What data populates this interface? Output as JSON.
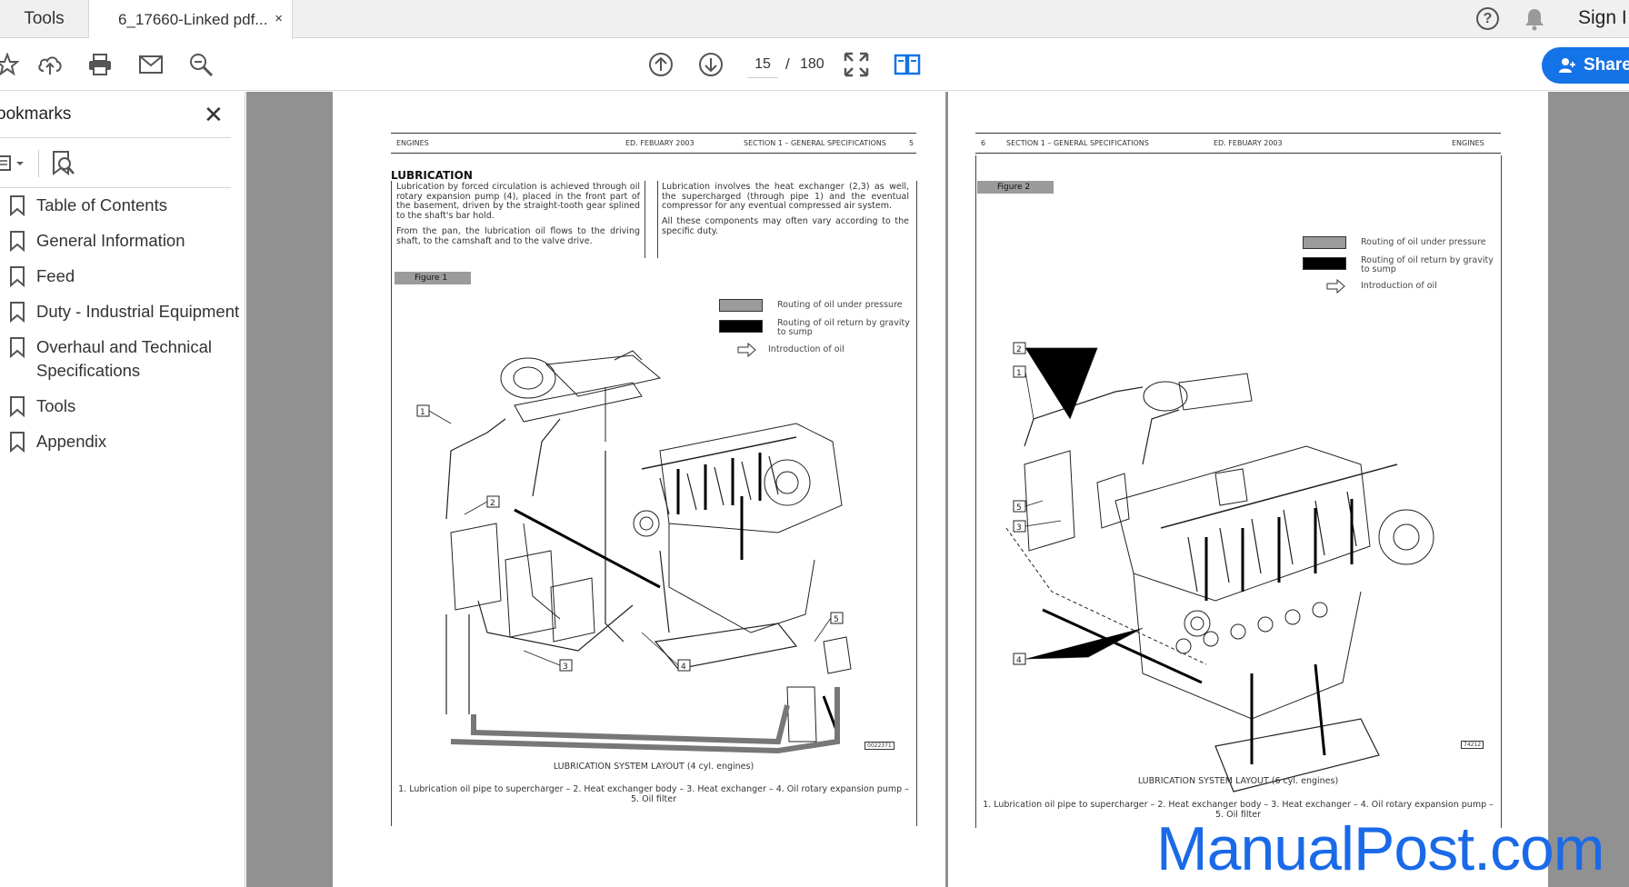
{
  "tabs": {
    "tools_label": "Tools",
    "doc_label": "6_17660-Linked pdf...",
    "close_glyph": "×"
  },
  "header_right": {
    "help_glyph": "?",
    "signin_label": "Sign I"
  },
  "toolbar": {
    "current_page": "15",
    "separator": "/",
    "total_pages": "180",
    "share_label": "Share"
  },
  "bookmarks": {
    "title": "ookmarks",
    "close_glyph": "✕",
    "items": [
      {
        "label": "Table of Contents"
      },
      {
        "label": "General Information"
      },
      {
        "label": "Feed"
      },
      {
        "label": "Duty - Industrial Equipment"
      },
      {
        "label": "Overhaul and Technical Specifications"
      },
      {
        "label": "Tools"
      },
      {
        "label": "Appendix"
      }
    ]
  },
  "page_left": {
    "header": {
      "left": "ENGINES",
      "center": "ED. FEBUARY 2003",
      "section": "SECTION 1 – GENERAL SPECIFICATIONS",
      "page_no": "5"
    },
    "section_title": "LUBRICATION",
    "col1_p1": "Lubrication by forced circulation is achieved through oil rotary expansion pump (4), placed in the front part of the basement, driven by the straight-tooth gear splined to the shaft's bar hold.",
    "col1_p2": "From the pan, the lubrication oil flows to the driving shaft, to the camshaft and to the valve drive.",
    "col2_p1": "Lubrication involves the heat exchanger (2,3) as well, the supercharged (through pipe 1) and the eventual compressor for any eventual compressed air system.",
    "col2_p2": "All these components may often vary according to the specific duty.",
    "figure_label": "Figure 1",
    "legend": {
      "pressure": "Routing of oil under pressure",
      "gravity": "Routing of oil return by gravity to sump",
      "intro": "Introduction of oil"
    },
    "callouts": [
      "1",
      "2",
      "3",
      "4",
      "5"
    ],
    "fig_code": "0022371",
    "caption_title": "LUBRICATION SYSTEM LAYOUT (4 cyl. engines)",
    "caption_text": "1. Lubrication oil pipe to supercharger – 2. Heat exchanger body – 3. Heat exchanger – 4. Oil rotary expansion pump – 5. Oil filter"
  },
  "page_right": {
    "header": {
      "page_no": "6",
      "section": "SECTION 1 – GENERAL SPECIFICATIONS",
      "center": "ED. FEBUARY 2003",
      "right": "ENGINES"
    },
    "figure_label": "Figure 2",
    "legend": {
      "pressure": "Routing of oil under pressure",
      "gravity": "Routing of oil return by gravity to sump",
      "intro": "Introduction of oil"
    },
    "callouts": [
      "2",
      "1",
      "5",
      "3",
      "4"
    ],
    "fig_code": "74212",
    "caption_title": "LUBRICATION SYSTEM LAYOUT (6 cyl. engines)",
    "caption_text": "1. Lubrication oil pipe to supercharger – 2. Heat exchanger body – 3. Heat exchanger – 4. Oil rotary expansion pump – 5. Oil filter"
  },
  "watermark": "ManualPost.com",
  "colors": {
    "accent": "#1473e6",
    "doc_background": "#919191",
    "legend_pressure": "#9b9b9b",
    "legend_gravity": "#000000",
    "watermark": "#1a6ae8"
  }
}
